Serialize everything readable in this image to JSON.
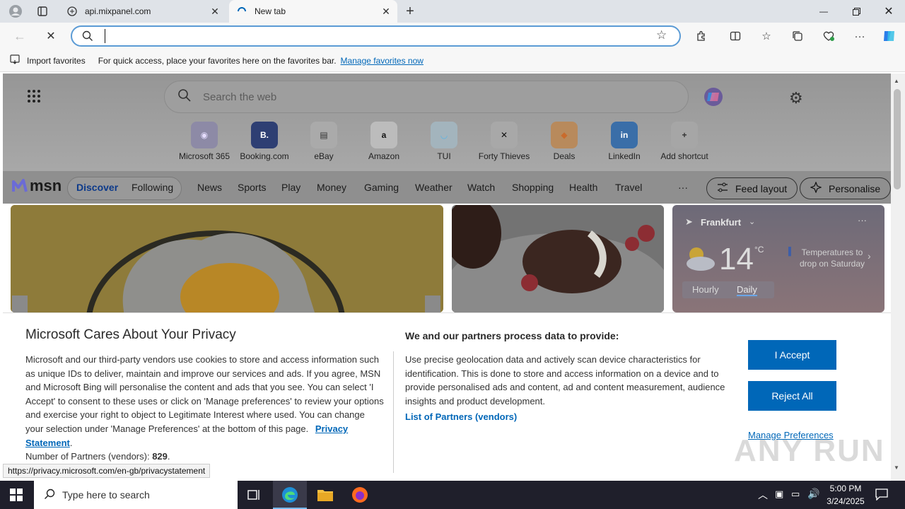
{
  "tabs": [
    {
      "title": "api.mixpanel.com"
    },
    {
      "title": "New tab"
    }
  ],
  "address": {
    "value": ""
  },
  "favbar": {
    "import_label": "Import favorites",
    "hint": "For quick access, place your favorites here on the favorites bar.",
    "manage_link": "Manage favorites now"
  },
  "msn": {
    "search_placeholder": "Search the web",
    "shortcuts": [
      {
        "label": "Microsoft 365",
        "icon": "m365-icon",
        "glyph": "◉"
      },
      {
        "label": "Booking.com",
        "icon": "booking-icon",
        "glyph": "B."
      },
      {
        "label": "eBay",
        "icon": "ebay-icon",
        "glyph": "▤"
      },
      {
        "label": "Amazon",
        "icon": "amazon-icon",
        "glyph": "a"
      },
      {
        "label": "TUI",
        "icon": "tui-icon",
        "glyph": "◡"
      },
      {
        "label": "Forty Thieves",
        "icon": "swords-icon",
        "glyph": "✕"
      },
      {
        "label": "Deals",
        "icon": "tag-icon",
        "glyph": "◆"
      },
      {
        "label": "LinkedIn",
        "icon": "linkedin-icon",
        "glyph": "in"
      },
      {
        "label": "Add shortcut",
        "icon": "plus-icon",
        "glyph": "+"
      }
    ],
    "logo": "msn",
    "nav": [
      "Discover",
      "Following",
      "News",
      "Sports",
      "Play",
      "Money",
      "Gaming",
      "Weather",
      "Watch",
      "Shopping",
      "Health",
      "Travel"
    ],
    "more": "···",
    "feed_layout": "Feed layout",
    "personalise": "Personalise",
    "weather": {
      "city": "Frankfurt",
      "temp": "14",
      "unit": "°C",
      "note_line1": "Temperatures to",
      "note_line2": "drop on Saturday",
      "tab_hourly": "Hourly",
      "tab_daily": "Daily"
    }
  },
  "privacy": {
    "title": "Microsoft Cares About Your Privacy",
    "body": "Microsoft and our third-party vendors use cookies to store and access information such as unique IDs to deliver, maintain and improve our services and ads. If you agree, MSN and Microsoft Bing will personalise the content and ads that you see. You can select 'I Accept' to consent to these uses or click on 'Manage preferences' to review your options and exercise your right to object to Legitimate Interest where used.  You can change your selection under 'Manage Preferences' at the bottom of this page.",
    "privacy_link": "Privacy Statement",
    "partners_label": "Number of Partners (vendors):",
    "partners_count": "829",
    "right_title": "We and our partners process data to provide:",
    "right_body": "Use precise geolocation data and actively scan device characteristics for identification. This is done to store and access information on a device and to provide personalised ads and content, ad and content measurement, audience insights and product development.",
    "list_link": "List of Partners (vendors)",
    "accept": "I Accept",
    "reject": "Reject All",
    "manage": "Manage Preferences"
  },
  "status_url": "https://privacy.microsoft.com/en-gb/privacystatement",
  "taskbar": {
    "search_placeholder": "Type here to search",
    "time": "5:00 PM",
    "date": "3/24/2025"
  },
  "watermark": "ANY RUN",
  "colors": {
    "accent": "#0067b8",
    "link": "#0067b8"
  }
}
